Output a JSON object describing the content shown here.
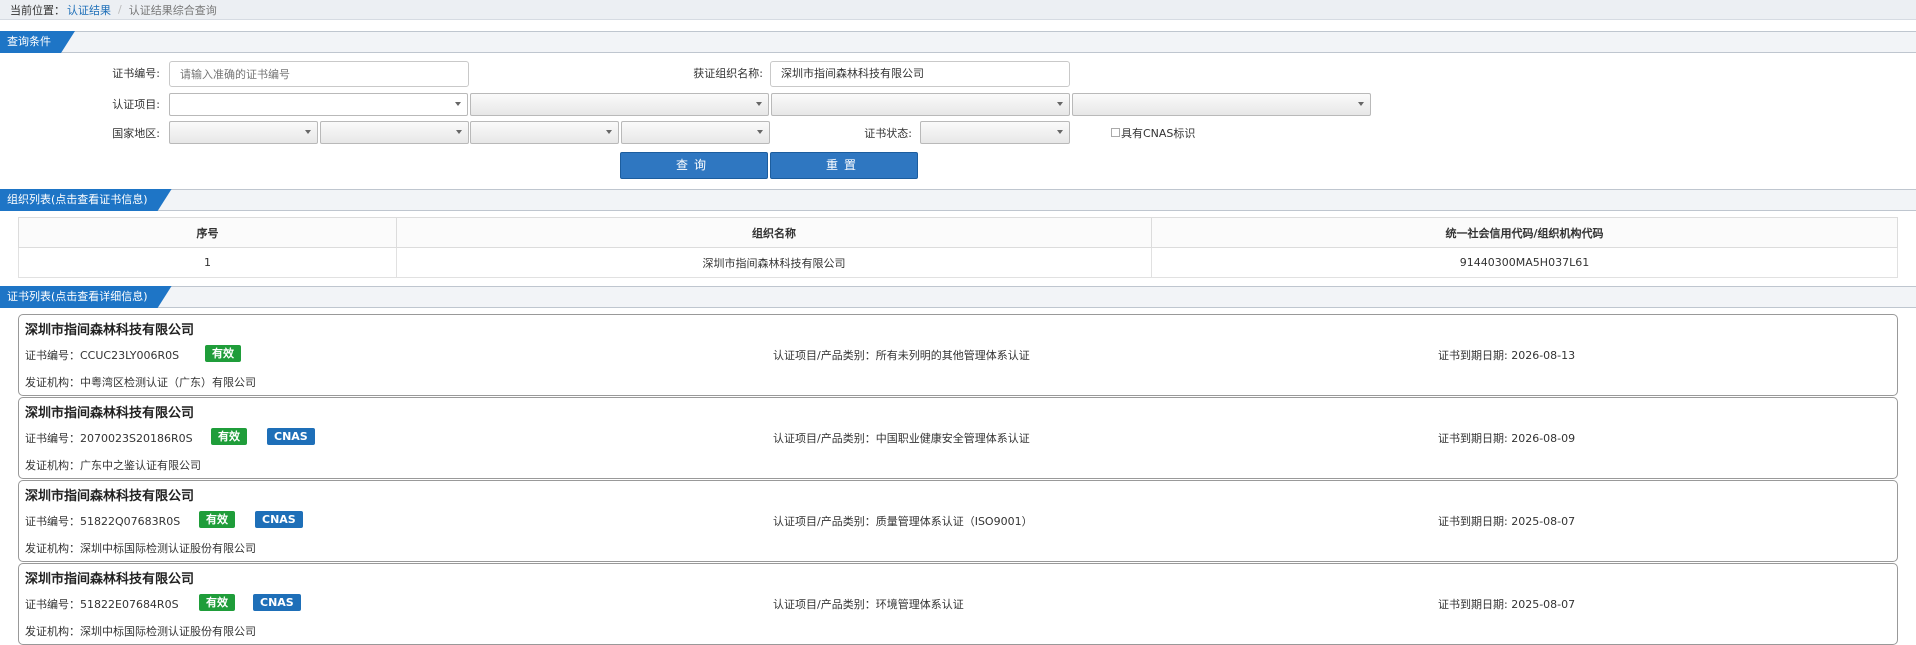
{
  "breadcrumb": {
    "current_label": "当前位置：",
    "link": "认证结果",
    "separator": "/",
    "page": "认证结果综合查询"
  },
  "query": {
    "section_title": "查询条件",
    "cert_no_label": "证书编号:",
    "cert_no_placeholder": "请输入准确的证书编号",
    "org_label": "获证组织名称:",
    "org_value": "深圳市指间森林科技有限公司",
    "project_label": "认证项目:",
    "region_label": "国家地区:",
    "status_label": "证书状态:",
    "cnas_checkbox_label": "具有CNAS标识",
    "search_button": "查询",
    "reset_button": "重置"
  },
  "org_list": {
    "section_title": "组织列表(点击查看证书信息)",
    "columns": [
      "序号",
      "组织名称",
      "统一社会信用代码/组织机构代码"
    ],
    "rows": [
      [
        "1",
        "深圳市指间森林科技有限公司",
        "91440300MA5H037L61"
      ]
    ]
  },
  "cert_list": {
    "section_title": "证书列表(点击查看详细信息)",
    "cards": [
      {
        "org": "深圳市指间森林科技有限公司",
        "cert_no": "证书编号：CCUC23LY006R0S",
        "status": "有效",
        "cnas": "",
        "project": "认证项目/产品类别：所有未列明的其他管理体系认证",
        "expiry": "证书到期日期: 2026-08-13",
        "issuer": "发证机构：中粤湾区检测认证（广东）有限公司"
      },
      {
        "org": "深圳市指间森林科技有限公司",
        "cert_no": "证书编号：2070023S20186R0S",
        "status": "有效",
        "cnas": "CNAS",
        "project": "认证项目/产品类别：中国职业健康安全管理体系认证",
        "expiry": "证书到期日期: 2026-08-09",
        "issuer": "发证机构：广东中之鉴认证有限公司"
      },
      {
        "org": "深圳市指间森林科技有限公司",
        "cert_no": "证书编号：51822Q07683R0S",
        "status": "有效",
        "cnas": "CNAS",
        "project": "认证项目/产品类别：质量管理体系认证（ISO9001）",
        "expiry": "证书到期日期: 2025-08-07",
        "issuer": "发证机构：深圳中标国际检测认证股份有限公司"
      },
      {
        "org": "深圳市指间森林科技有限公司",
        "cert_no": "证书编号：51822E07684R0S",
        "status": "有效",
        "cnas": "CNAS",
        "project": "认证项目/产品类别：环境管理体系认证",
        "expiry": "证书到期日期: 2025-08-07",
        "issuer": "发证机构：深圳中标国际检测认证股份有限公司"
      }
    ]
  }
}
